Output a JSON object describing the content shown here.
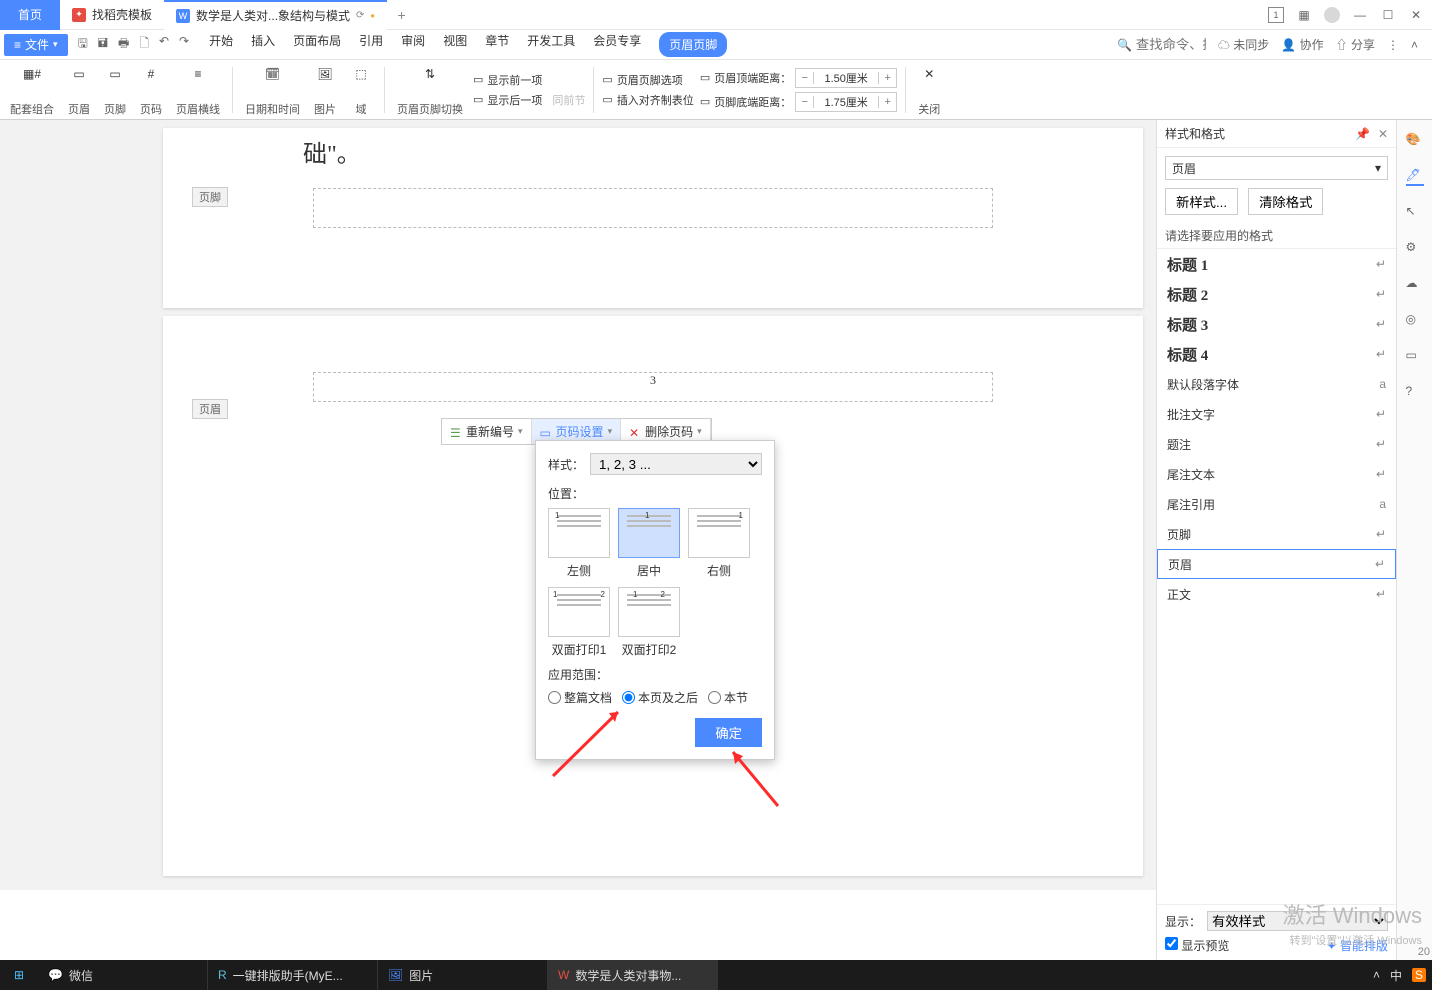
{
  "tabs": {
    "home": "首页",
    "shell": "找稻壳模板",
    "doc": "数学是人类对...象结构与模式",
    "plus": "+"
  },
  "menubar": {
    "file": "文件",
    "items": [
      "开始",
      "插入",
      "页面布局",
      "引用",
      "审阅",
      "视图",
      "章节",
      "开发工具",
      "会员专享"
    ],
    "active_pill": "页眉页脚",
    "search_ph": "查找命令、搜索模板",
    "unsync": "未同步",
    "collab": "协作",
    "share": "分享"
  },
  "ribbon": {
    "g1": "配套组合",
    "g2": "页眉",
    "g3": "页脚",
    "g4": "页码",
    "g5": "页眉横线",
    "g6": "日期和时间",
    "g7": "图片",
    "g8": "域",
    "g9": "页眉页脚切换",
    "s1": "显示前一项",
    "s2": "显示后一项",
    "s3": "同前节",
    "o1": "页眉页脚选项",
    "o2": "插入对齐制表位",
    "d1": "页眉顶端距离：",
    "d2": "页脚底端距离：",
    "v1": "1.50厘米",
    "v2": "1.75厘米",
    "close": "关闭"
  },
  "doc": {
    "quote": "础\"。",
    "footer_tag": "页脚",
    "header_tag": "页眉",
    "page_number": "3"
  },
  "float_toolbar": {
    "b1": "重新编号",
    "b2": "页码设置",
    "b3": "删除页码"
  },
  "popup": {
    "style_label": "样式：",
    "style_value": "1, 2, 3 ...",
    "pos_label": "位置：",
    "pos_opts": [
      "左侧",
      "居中",
      "右侧",
      "双面打印1",
      "双面打印2"
    ],
    "apply_label": "应用范围：",
    "r1": "整篇文档",
    "r2": "本页及之后",
    "r3": "本节",
    "ok": "确定"
  },
  "panel": {
    "title": "样式和格式",
    "current": "页眉",
    "new_style": "新样式...",
    "clear": "清除格式",
    "hint": "请选择要应用的格式",
    "items": [
      {
        "t": "标题 1",
        "cls": "heading",
        "m": "↵"
      },
      {
        "t": "标题 2",
        "cls": "heading",
        "m": "↵"
      },
      {
        "t": "标题 3",
        "cls": "heading",
        "m": "↵"
      },
      {
        "t": "标题 4",
        "cls": "heading",
        "m": "↵"
      },
      {
        "t": "默认段落字体",
        "cls": "",
        "m": "a"
      },
      {
        "t": "批注文字",
        "cls": "",
        "m": "↵"
      },
      {
        "t": "题注",
        "cls": "",
        "m": "↵"
      },
      {
        "t": "尾注文本",
        "cls": "",
        "m": "↵"
      },
      {
        "t": "尾注引用",
        "cls": "",
        "m": "a"
      },
      {
        "t": "页脚",
        "cls": "",
        "m": "↵"
      },
      {
        "t": "页眉",
        "cls": "",
        "m": "↵",
        "hl": true
      },
      {
        "t": "正文",
        "cls": "",
        "m": "↵"
      }
    ],
    "show_label": "显示：",
    "show_value": "有效样式",
    "preview": "显示预览",
    "smart": "智能排版"
  },
  "taskbar": {
    "items": [
      "微信",
      "一键排版助手(MyE...",
      "图片",
      "数学是人类对事物..."
    ],
    "tray": "^ 中 S",
    "num": "20"
  },
  "watermark": "激活 Windows",
  "watermark2": "转到\"设置\"以激活 Windows"
}
